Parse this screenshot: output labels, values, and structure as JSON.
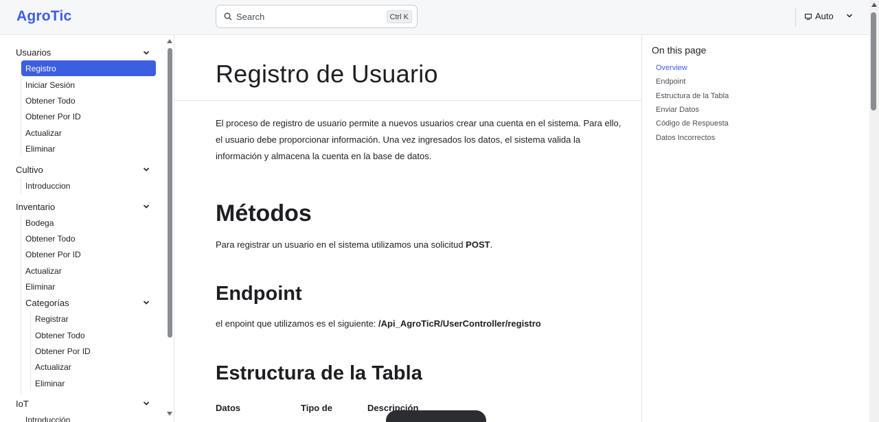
{
  "header": {
    "brand": "AgroTic",
    "search_placeholder": "Search",
    "search_shortcut": "Ctrl K",
    "theme_label": "Auto"
  },
  "sidebar": {
    "sections": [
      {
        "label": "Usuarios",
        "items": [
          "Registro",
          "Iniciar Sesión",
          "Obtener Todo",
          "Obtener Por ID",
          "Actualizar",
          "Eliminar"
        ]
      },
      {
        "label": "Cultivo",
        "items": [
          "Introduccion"
        ]
      },
      {
        "label": "Inventario",
        "items": [
          "Bodega",
          "Obtener Todo",
          "Obtener Por ID",
          "Actualizar",
          "Eliminar"
        ]
      },
      {
        "label": "Categorías",
        "items": [
          "Registrar",
          "Obtener Todo",
          "Obtener Por ID",
          "Actualizar",
          "Eliminar"
        ]
      },
      {
        "label": "IoT",
        "items": [
          "Introducción"
        ]
      }
    ],
    "active_item": "Registro"
  },
  "main": {
    "title": "Registro de Usuario",
    "intro": "El proceso de registro de usuario permite a nuevos usuarios crear una cuenta en el sistema. Para ello, el usuario debe proporcionar información. Una vez ingresados los datos, el sistema valida la información y almacena la cuenta en la base de datos.",
    "metodos_heading": "Métodos",
    "metodos_text_prefix": "Para registrar un usuario en el sistema utilizamos una solicitud ",
    "metodos_text_bold": "POST",
    "metodos_text_suffix": ".",
    "endpoint_heading": "Endpoint",
    "endpoint_text_prefix": "el enpoint que utilizamos es el siguiente: ",
    "endpoint_path": "/Api_AgroTicR/UserController/registro",
    "tabla_heading": "Estructura de la Tabla",
    "table_headers": [
      "Datos",
      "Tipo de",
      "Descripción"
    ]
  },
  "toc": {
    "title": "On this page",
    "items": [
      "Overview",
      "Endpoint",
      "Estructura de la Tabla",
      "Enviar Datos",
      "Código de Respuesta",
      "Datos Incorrectos"
    ],
    "active": "Overview"
  },
  "colors": {
    "accent": "#3c5ee0",
    "text": "#1c1e21",
    "border": "#e3e5e8"
  }
}
